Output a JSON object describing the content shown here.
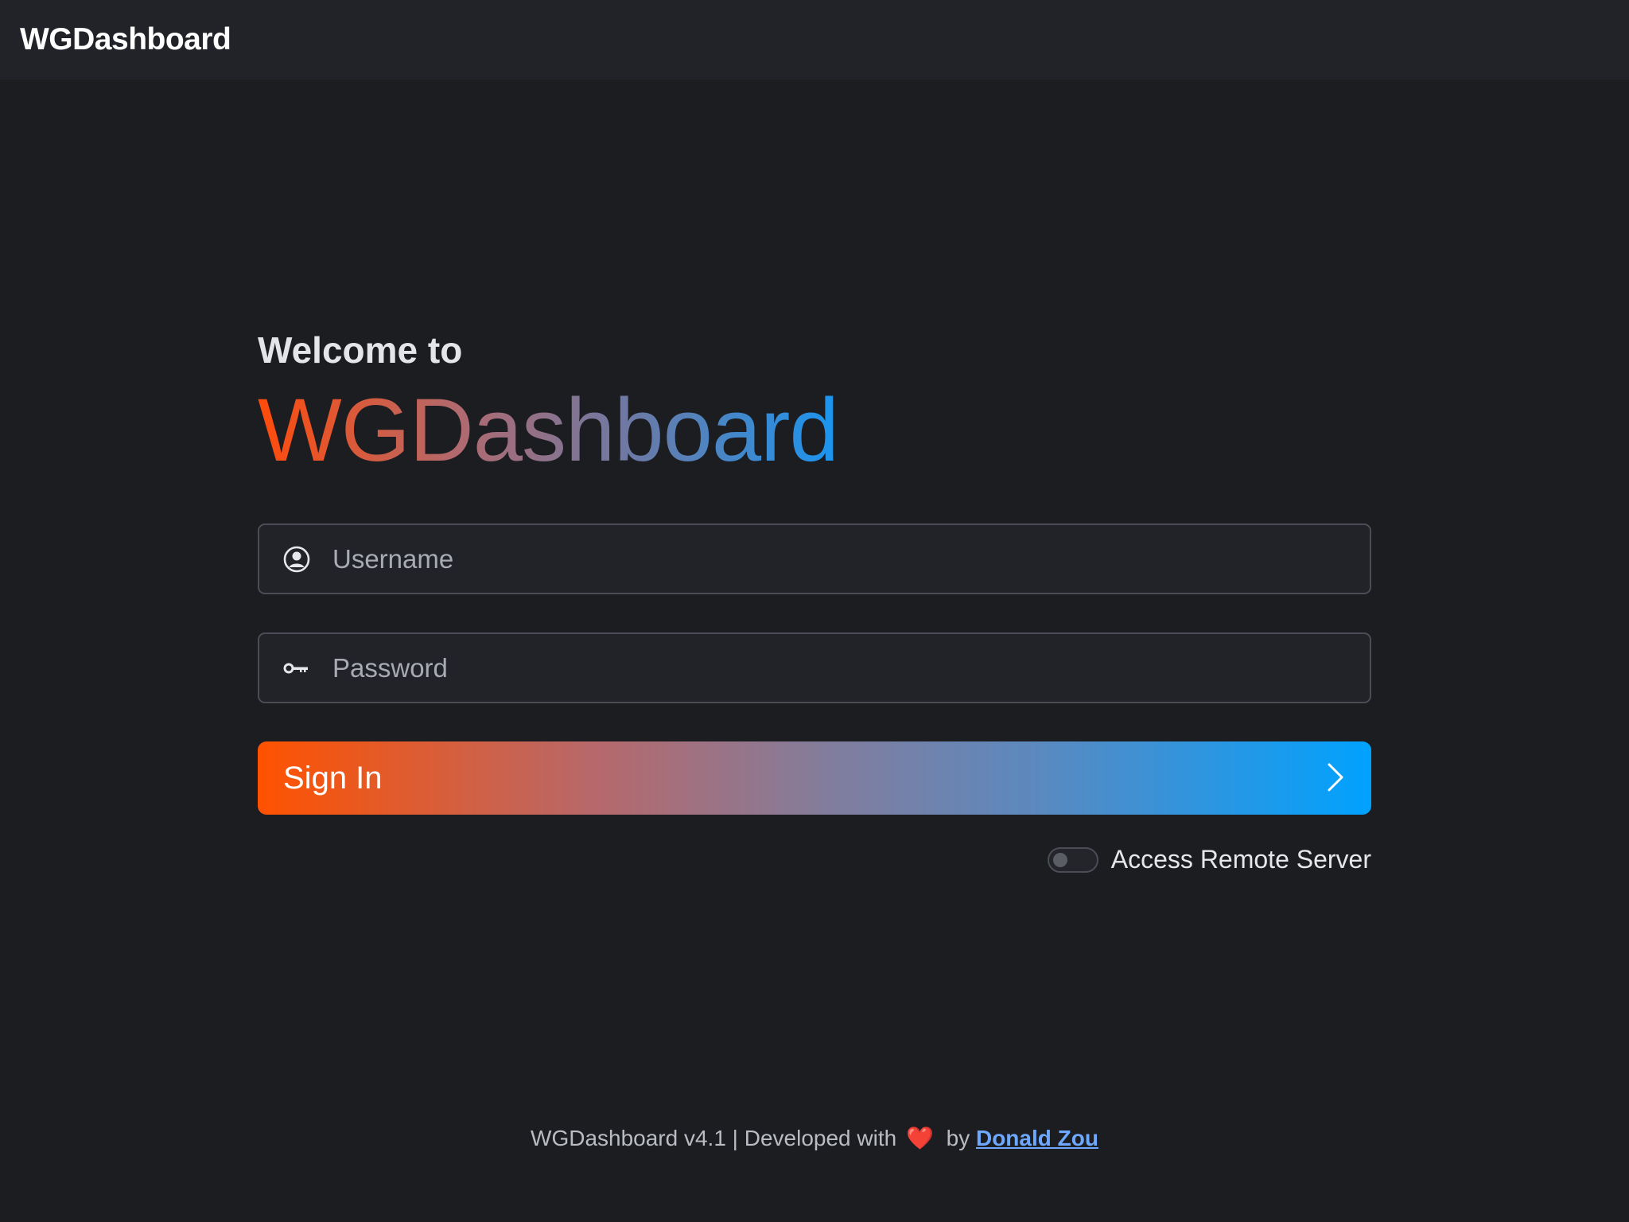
{
  "topbar": {
    "brand": "WGDashboard"
  },
  "login": {
    "welcome": "Welcome to",
    "title": "WGDashboard",
    "username": {
      "placeholder": "Username",
      "value": "",
      "icon": "user-circle-icon"
    },
    "password": {
      "placeholder": "Password",
      "value": "",
      "icon": "key-icon"
    },
    "signin_label": "Sign In",
    "signin_icon": "chevron-right-icon",
    "remote_label": "Access Remote Server",
    "remote_enabled": false
  },
  "footer": {
    "text_before": "WGDashboard v4.1 | Developed with",
    "heart": "❤️",
    "by": "by",
    "author_link": "Donald Zou"
  },
  "colors": {
    "background": "#1c1d21",
    "topbar": "#212328",
    "gradient_start": "#ff5200",
    "gradient_end": "#00a2ff",
    "link": "#6ea8fe"
  }
}
